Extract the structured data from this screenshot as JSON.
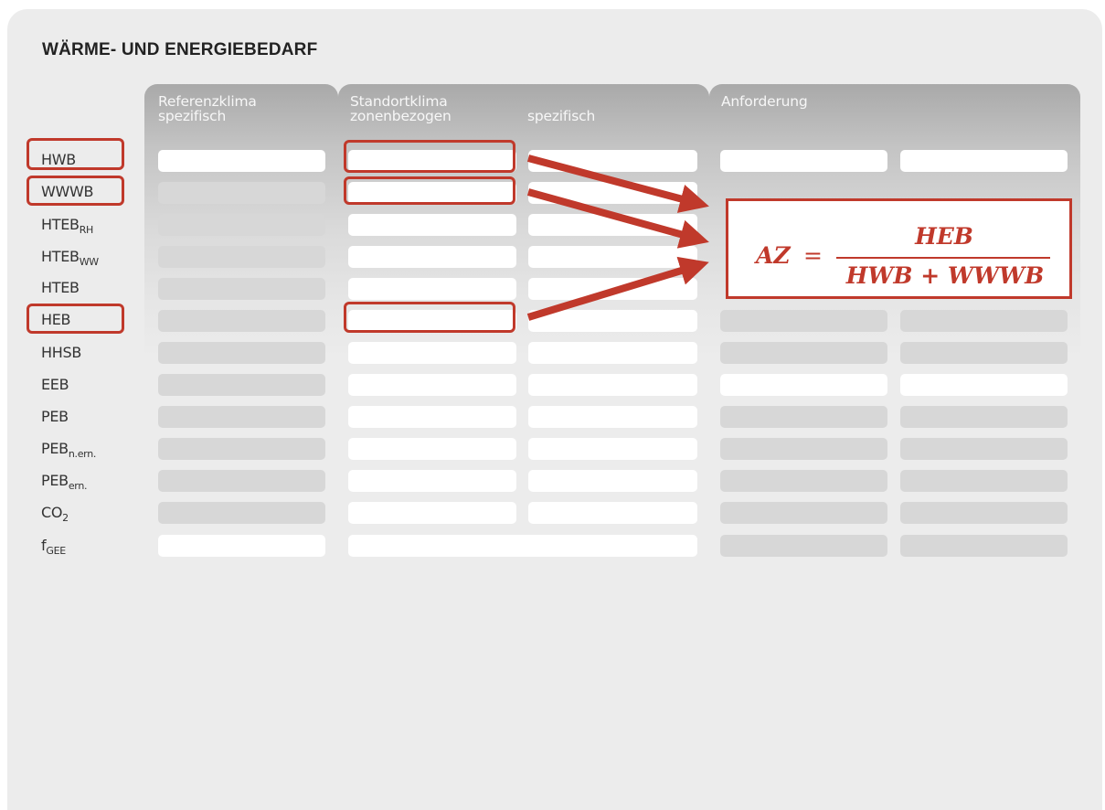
{
  "title": "WÄRME- UND ENERGIEBEDARF",
  "columns": {
    "referenzklima": {
      "line1": "Referenzklima",
      "line2": "spezifisch"
    },
    "standortklima": {
      "line1": "Standortklima",
      "line2": "zonenbezogen",
      "line2b": "spezifisch"
    },
    "anforderung": {
      "line1": "Anforderung"
    }
  },
  "rows": [
    {
      "label": "HWB",
      "sub": ""
    },
    {
      "label": "WWWB",
      "sub": ""
    },
    {
      "label": "HTEB",
      "sub": "RH"
    },
    {
      "label": "HTEB",
      "sub": "WW"
    },
    {
      "label": "HTEB",
      "sub": ""
    },
    {
      "label": "HEB",
      "sub": ""
    },
    {
      "label": "HHSB",
      "sub": ""
    },
    {
      "label": "EEB",
      "sub": ""
    },
    {
      "label": "PEB",
      "sub": ""
    },
    {
      "label": "PEB",
      "sub": "n.ern."
    },
    {
      "label": "PEB",
      "sub": "ern."
    },
    {
      "label": "CO",
      "sub": "2"
    },
    {
      "label": "f",
      "sub": "GEE"
    }
  ],
  "formula": {
    "lhs": "AZ",
    "equals": "=",
    "numerator": "HEB",
    "denominator": "HWB + WWWB"
  },
  "colors": {
    "highlight": "#c0392b",
    "panel": "#ececec",
    "cell_white": "#ffffff",
    "cell_grey": "#d7d7d7"
  }
}
